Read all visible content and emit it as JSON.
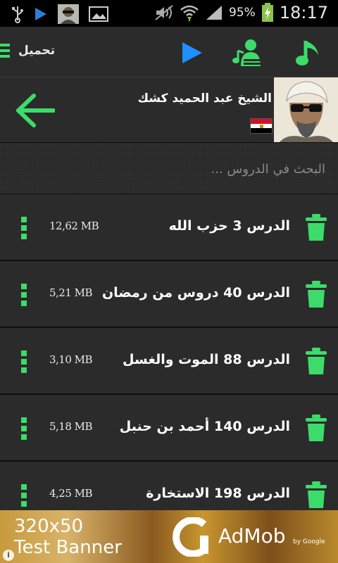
{
  "status_bar": {
    "battery_percent": "95%",
    "time": "18:17"
  },
  "toolbar": {
    "menu_label": "تحميل"
  },
  "profile": {
    "name": "الشيخ عبد الحميد كشك",
    "flag_colors": [
      "#ce1126",
      "#ffffff",
      "#000000"
    ]
  },
  "search": {
    "placeholder": "البحث في الدروس ..."
  },
  "lessons": [
    {
      "title": "الدرس 3 حزب الله",
      "size": "12,62 MB"
    },
    {
      "title": "الدرس 40 دروس من رمضان",
      "size": "5,21 MB"
    },
    {
      "title": "الدرس 88 الموت والغسل",
      "size": "3,10 MB"
    },
    {
      "title": "الدرس 140 أحمد بن حنبل",
      "size": "5,18 MB"
    },
    {
      "title": "الدرس 198 الاستخارة",
      "size": "4,25 MB"
    }
  ],
  "ad": {
    "line1": "320x50",
    "line2": "Test Banner",
    "brand": "AdMob",
    "by": "by Google"
  },
  "colors": {
    "accent": "#3ddc6a",
    "play": "#1e90ff",
    "background": "#2b2b2b"
  }
}
